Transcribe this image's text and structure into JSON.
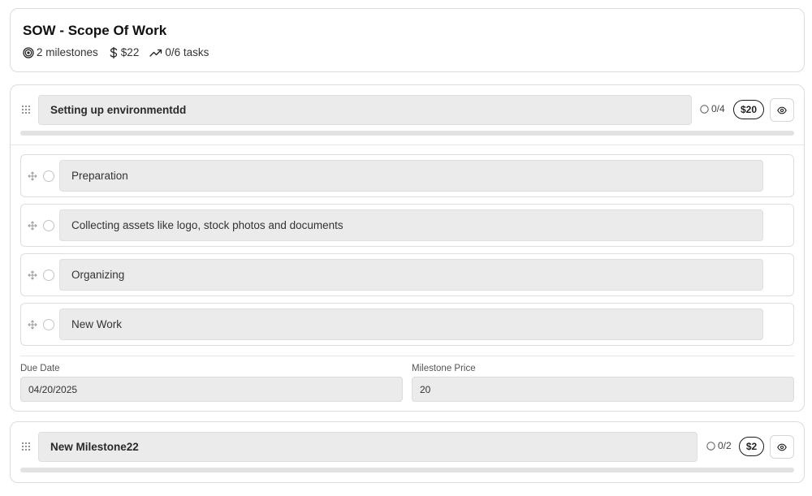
{
  "sow": {
    "title": "SOW - Scope Of Work",
    "stats": {
      "milestones": "2 milestones",
      "price": "$22",
      "tasks": "0/6 tasks"
    }
  },
  "milestones": [
    {
      "name": "Setting up environmentdd",
      "task_count": "0/4",
      "price": "$20",
      "progress": 0,
      "tasks": [
        {
          "label": "Preparation"
        },
        {
          "label": "Collecting assets like logo, stock photos and documents"
        },
        {
          "label": "Organizing"
        },
        {
          "label": "New Work"
        }
      ],
      "due_date_label": "Due Date",
      "due_date": "04/20/2025",
      "price_label": "Milestone Price",
      "price_value": "20"
    },
    {
      "name": "New Milestone22",
      "task_count": "0/2",
      "price": "$2",
      "progress": 0
    }
  ]
}
